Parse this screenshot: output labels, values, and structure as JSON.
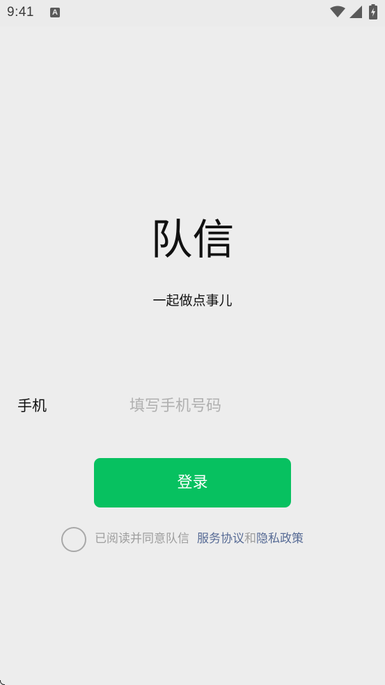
{
  "status_bar": {
    "time": "9:41",
    "notification_icon_letter": "A",
    "icons": [
      "wifi-icon",
      "signal-icon",
      "battery-charging-icon"
    ],
    "icon_color": "#5a5a5a"
  },
  "app": {
    "title": "队信",
    "slogan": "一起做点事儿"
  },
  "login_form": {
    "phone_label": "手机",
    "phone_placeholder": "填写手机号码",
    "phone_value": "",
    "login_button_label": "登录",
    "button_color": "#07c160"
  },
  "agreement": {
    "checked": false,
    "prefix": "已阅读并同意队信",
    "service_link": "服务协议",
    "conjunction": "和",
    "privacy_link": "隐私政策",
    "link_color": "#576b95"
  }
}
